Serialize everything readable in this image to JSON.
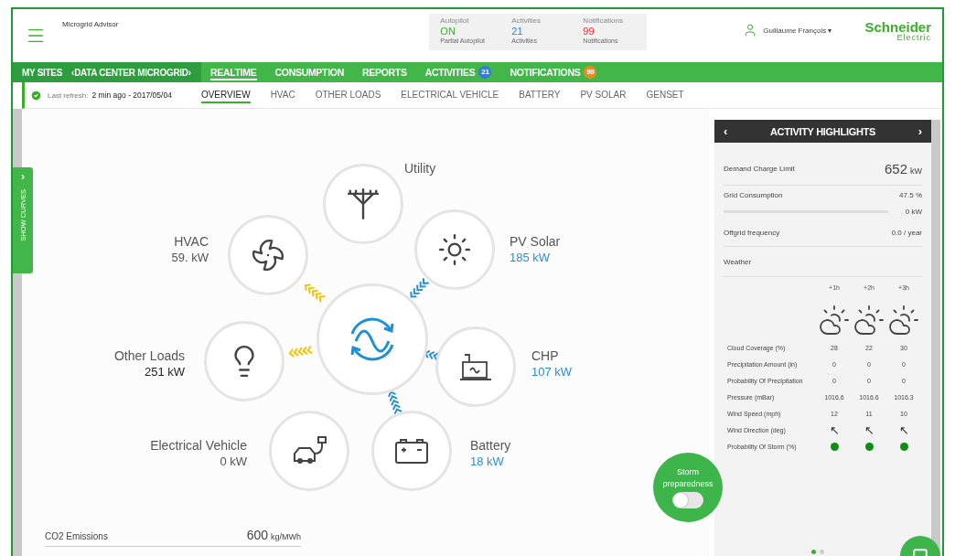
{
  "app": {
    "title": "Microgrid Advisor"
  },
  "status": [
    {
      "label": "Autopilot",
      "value": "ON",
      "caption": "Partial Autopilot",
      "color": "#3dae2b"
    },
    {
      "label": "Activities",
      "value": "21",
      "caption": "Activities",
      "color": "#2f7fd6"
    },
    {
      "label": "Notifications",
      "value": "99",
      "caption": "Notifications",
      "color": "#e0332f"
    }
  ],
  "user": {
    "name": "Guillaume François",
    "caret": "▾"
  },
  "logo": {
    "line1": "Schneider",
    "line2": "Electric"
  },
  "nav": {
    "sites": "MY SITES",
    "site": "‹DATA CENTER MICROGRID›",
    "items": [
      {
        "label": "REALTIME",
        "selected": true
      },
      {
        "label": "CONSUMPTION",
        "selected": false
      },
      {
        "label": "REPORTS",
        "selected": false
      },
      {
        "label": "ACTIVITIES",
        "selected": false,
        "badge": "21",
        "color": "#2f7fd6"
      },
      {
        "label": "NOTIFICATIONS",
        "selected": false,
        "badge": "99",
        "color": "#f08a1c"
      }
    ]
  },
  "subnav": {
    "refresh_label": "Last refresh:",
    "refresh_value": "2 min ago - 2017/05/04",
    "tabs": [
      {
        "label": "OVERVIEW",
        "selected": true
      },
      {
        "label": "HVAC",
        "selected": false
      },
      {
        "label": "OTHER LOADS",
        "selected": false
      },
      {
        "label": "ELECTRICAL VEHICLE",
        "selected": false
      },
      {
        "label": "BATTERY",
        "selected": false
      },
      {
        "label": "PV SOLAR",
        "selected": false
      },
      {
        "label": "GENSET",
        "selected": false
      }
    ]
  },
  "side_tab": {
    "label": "SHOW CURVES",
    "chevron": "›"
  },
  "nodes": [
    {
      "kind": "utility",
      "label": "Utility",
      "consuming": false,
      "supplying": false
    },
    {
      "kind": "hvac",
      "label": "HVAC",
      "value": "59. kW",
      "consuming": true,
      "supplying": false
    },
    {
      "kind": "solar",
      "label": "PV Solar",
      "value": "185 kW",
      "consuming": false,
      "supplying": true
    },
    {
      "kind": "loads",
      "label": "Other Loads",
      "value": "251 kW",
      "consuming": true,
      "supplying": false
    },
    {
      "kind": "chp",
      "label": "CHP",
      "value": "107 kW",
      "consuming": false,
      "supplying": true
    },
    {
      "kind": "ev",
      "label": "Electrical Vehicle",
      "value": "0 kW",
      "consuming": false,
      "supplying": false
    },
    {
      "kind": "battery",
      "label": "Battery",
      "value": "18 kW",
      "consuming": false,
      "supplying": true
    }
  ],
  "storm": {
    "label": "Storm preparedness",
    "on": false
  },
  "co2": {
    "label": "CO2 Emissions",
    "value": "600",
    "unit": "kg/MWh"
  },
  "highlights": {
    "title": "ACTIVITY HIGHLIGHTS",
    "prev": "‹",
    "next": "›",
    "rows": [
      {
        "kind": "big",
        "label": "Demand Charge Limit",
        "value": "652",
        "unit": "kW"
      },
      {
        "kind": "plain",
        "label": "Grid Consumption",
        "value": "47.5 %"
      },
      {
        "kind": "bar",
        "level": 0,
        "value": "0 kW"
      },
      {
        "kind": "plain",
        "label": "Offgrid frequency",
        "value": "0.0 / year"
      },
      {
        "kind": "heading",
        "label": "Weather"
      }
    ]
  },
  "weather": {
    "columns": [
      "+1h",
      "+2h",
      "+3h"
    ],
    "rows": [
      {
        "kind": "text",
        "label": "Cloud Coverage (%)",
        "values": [
          "28",
          "22",
          "30"
        ]
      },
      {
        "kind": "text",
        "label": "Precipitation Amount (in)",
        "values": [
          "0",
          "0",
          "0"
        ]
      },
      {
        "kind": "text",
        "label": "Probability Of Precipitation",
        "values": [
          "0",
          "0",
          "0"
        ]
      },
      {
        "kind": "text",
        "label": "Pressure (mBar)",
        "values": [
          "1016.6",
          "1016.6",
          "1016.3"
        ]
      },
      {
        "kind": "text",
        "label": "Wind Speed (mph)",
        "values": [
          "12",
          "11",
          "10"
        ]
      },
      {
        "kind": "arrows",
        "label": "Wind Direction (deg)",
        "values": [
          "↖",
          "↖",
          "↖"
        ]
      },
      {
        "kind": "dots",
        "label": "Probability Of Storm (%)",
        "dots": [
          {
            "color": "#138a17"
          },
          {
            "color": "#138a17"
          },
          {
            "color": "#138a17"
          }
        ]
      }
    ]
  },
  "pager": [
    {
      "selected": true
    },
    {
      "selected": false
    }
  ]
}
